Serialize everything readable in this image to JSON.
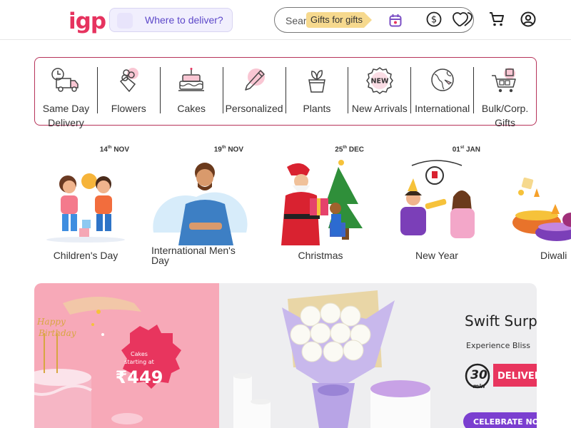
{
  "header": {
    "logo": "igp",
    "deliver_label": "Where to deliver?",
    "search_placeholder": "Search",
    "search_hint": "Gifts for gifts",
    "icons": [
      "calendar-icon",
      "currency-icon",
      "heart-icon",
      "cart-icon",
      "account-icon"
    ]
  },
  "categories": [
    {
      "label": "Same Day Delivery",
      "icon": "delivery-truck-icon"
    },
    {
      "label": "Flowers",
      "icon": "flowers-icon"
    },
    {
      "label": "Cakes",
      "icon": "cake-icon"
    },
    {
      "label": "Personalized",
      "icon": "pencil-icon"
    },
    {
      "label": "Plants",
      "icon": "plant-icon"
    },
    {
      "label": "New Arrivals",
      "icon": "new-badge-icon"
    },
    {
      "label": "International",
      "icon": "globe-icon"
    },
    {
      "label": "Bulk/Corp. Gifts",
      "icon": "bulk-cart-icon"
    }
  ],
  "occasions": [
    {
      "name": "Children's Day",
      "date_day": "14",
      "date_suffix": "th",
      "date_month": "NOV"
    },
    {
      "name": "International Men's Day",
      "date_day": "19",
      "date_suffix": "th",
      "date_month": "NOV"
    },
    {
      "name": "Christmas",
      "date_day": "25",
      "date_suffix": "th",
      "date_month": "DEC"
    },
    {
      "name": "New Year",
      "date_day": "01",
      "date_suffix": "st",
      "date_month": "JAN"
    },
    {
      "name": "Diwali"
    }
  ],
  "banners": {
    "cake": {
      "line1": "Cakes",
      "line2": "starting at",
      "price": "₹449",
      "topper_line1": "Happy",
      "topper_line2": "Birthday"
    },
    "swift": {
      "title": "Swift Surp",
      "subtitle": "Experience Bliss",
      "badge_number": "30",
      "badge_unit": "min",
      "badge_label": "DELIVERY",
      "cta": "CELEBRATE NOW"
    }
  },
  "colors": {
    "brand": "#e6335f",
    "accent_purple": "#5d48c9",
    "category_border": "#b7335a"
  }
}
